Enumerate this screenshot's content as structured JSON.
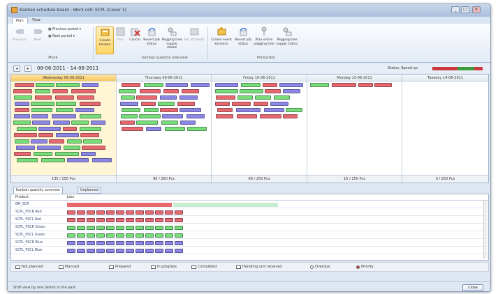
{
  "window": {
    "title": "Kanban schedule board - Work cell: SCPL (Cover 1)",
    "min": "_",
    "max": "□",
    "close": "✕"
  },
  "ribbon_tabs": [
    "Plan",
    "View"
  ],
  "ribbon": {
    "move": {
      "previous": "Previous",
      "next": "Next",
      "previous_period": "Previous period",
      "next_period": "Next period",
      "group": "Move"
    },
    "kanban_overview": {
      "create": "Create kanban",
      "plan": "Plan",
      "cancel": "Cancel",
      "revert": "Revert job status",
      "pegging": "Pegging tree supply status",
      "set_override": "Set attribute",
      "group": "Kanban quantity overview"
    },
    "production": {
      "create_event": "Create event kanbans",
      "revert": "Revert job status",
      "plan_entire": "Plan entire pegging tree",
      "pegging": "Pegging tree supply status",
      "group": "Production"
    }
  },
  "nav": {
    "prev": "◂",
    "next": "▸",
    "date_range": "08-06-2011 - 14-06-2011",
    "speed_label": "Status: Speed up"
  },
  "colors": {
    "red": "#e9686e",
    "green": "#77dd77",
    "blue": "#8c86e6",
    "dark_red": "#c9383c",
    "dark_green": "#3a9b3a",
    "accent_yellow": "#ffd666"
  },
  "days": [
    {
      "label": "Wednesday 08-06-2011",
      "footer": "135 / 250 Pcs",
      "current": true
    },
    {
      "label": "Thursday 09-06-2011",
      "footer": "90 / 250 Pcs",
      "current": false
    },
    {
      "label": "Friday 10-06-2011",
      "footer": "60 / 250 Pcs",
      "current": false
    },
    {
      "label": "Monday 13-06-2011",
      "footer": "15 / 250 Pcs",
      "current": false
    },
    {
      "label": "Tuesday 14-06-2011",
      "footer": "0 / 250 Pcs",
      "current": false
    }
  ],
  "lower_tabs": [
    "Kanban quantity overview",
    "Unplanned"
  ],
  "qgrid": {
    "header_product": "Product",
    "header_jobs": "Jobs",
    "rows": [
      {
        "name": "BM_SCR",
        "kind": "summary"
      },
      {
        "name": "SCPL_PSCR Red",
        "kind": "red"
      },
      {
        "name": "SCPL_PSCL Red",
        "kind": "red"
      },
      {
        "name": "SCPL_PSCR Green",
        "kind": "green"
      },
      {
        "name": "SCPL_PSCL Green",
        "kind": "green"
      },
      {
        "name": "SCPL_PSCR Blue",
        "kind": "blue"
      },
      {
        "name": "SCPL_PSCL Blue",
        "kind": "blue"
      }
    ]
  },
  "legend": [
    {
      "label": "Not planned",
      "icon": "not-planned-icon"
    },
    {
      "label": "Planned",
      "icon": "planned-icon"
    },
    {
      "label": "Prepared",
      "icon": "prepared-icon"
    },
    {
      "label": "In progress",
      "icon": "in-progress-icon"
    },
    {
      "label": "Completed",
      "icon": "completed-icon"
    },
    {
      "label": "Handling unit received",
      "icon": "handling-unit-icon"
    },
    {
      "label": "Overdue",
      "icon": "overdue-icon"
    },
    {
      "label": "Priority",
      "icon": "priority-icon"
    }
  ],
  "status": {
    "text": "Shift view by one period in the past",
    "close": "Close"
  }
}
